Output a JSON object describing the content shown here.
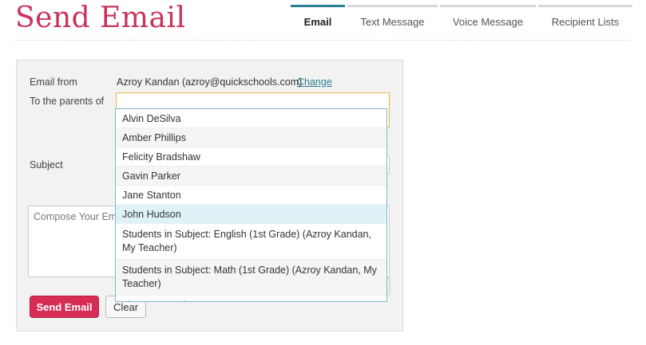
{
  "page": {
    "title": "Send Email"
  },
  "tabs": [
    {
      "label": "Email"
    },
    {
      "label": "Text Message"
    },
    {
      "label": "Voice Message"
    },
    {
      "label": "Recipient Lists"
    }
  ],
  "form": {
    "from_label": "Email from",
    "from_value": "Azroy Kandan (azroy@quickschools.com)",
    "change_link": "Change",
    "to_label": "To the parents of",
    "to_value": "",
    "subject_label": "Subject",
    "subject_value": "",
    "compose_placeholder": "Compose Your Email Here",
    "send_label": "Send Email",
    "clear_label": "Clear"
  },
  "dropdown": {
    "items": [
      {
        "label": "Alvin DeSilva"
      },
      {
        "label": "Amber Phillips"
      },
      {
        "label": "Felicity Bradshaw"
      },
      {
        "label": "Gavin Parker"
      },
      {
        "label": "Jane Stanton"
      },
      {
        "label": "John Hudson"
      },
      {
        "label": "Students in Subject: English (1st Grade) (Azroy Kandan, My Teacher)"
      },
      {
        "label": "Students in Subject: Math (1st Grade) (Azroy Kandan, My Teacher)"
      },
      {
        "label": "List: Azroy's List"
      }
    ],
    "highlighted_index": 5
  },
  "colors": {
    "brand": "#c8345a",
    "accent": "#2a7f93",
    "send_button": "#d62c55",
    "focus_border": "#e9b54a"
  }
}
